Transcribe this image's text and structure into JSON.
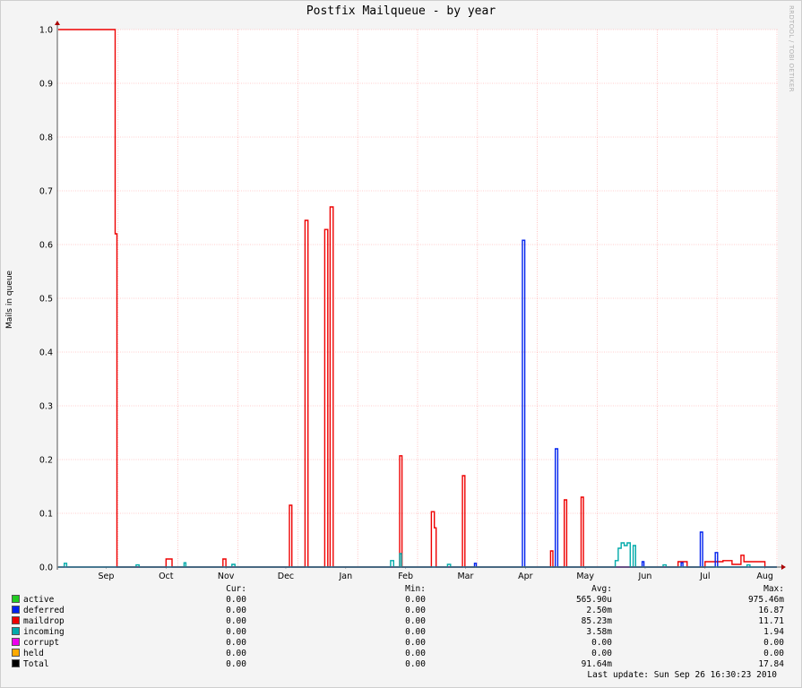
{
  "title": "Postfix Mailqueue - by year",
  "watermark": "RRDTOOL / TOBI OETIKER",
  "legend_header": {
    "cur": "Cur:",
    "min": "Min:",
    "avg": "Avg:",
    "max": "Max:"
  },
  "legend": [
    {
      "name": "active",
      "color": "#22cc22",
      "cur": "0.00",
      "min": "0.00",
      "avg": "565.90u",
      "max": "975.46m"
    },
    {
      "name": "deferred",
      "color": "#0022ee",
      "cur": "0.00",
      "min": "0.00",
      "avg": "2.50m",
      "max": "16.87"
    },
    {
      "name": "maildrop",
      "color": "#ee0000",
      "cur": "0.00",
      "min": "0.00",
      "avg": "85.23m",
      "max": "11.71"
    },
    {
      "name": "incoming",
      "color": "#00aaaa",
      "cur": "0.00",
      "min": "0.00",
      "avg": "3.58m",
      "max": "1.94"
    },
    {
      "name": "corrupt",
      "color": "#ee00ee",
      "cur": "0.00",
      "min": "0.00",
      "avg": "0.00",
      "max": "0.00"
    },
    {
      "name": "held",
      "color": "#ffaa00",
      "cur": "0.00",
      "min": "0.00",
      "avg": "0.00",
      "max": "0.00"
    },
    {
      "name": "Total",
      "color": "#000000",
      "cur": "0.00",
      "min": "0.00",
      "avg": "91.64m",
      "max": "17.84"
    }
  ],
  "last_update": "Last update: Sun Sep 26 16:30:23 2010",
  "chart_data": {
    "type": "line",
    "ylabel": "Mails in queue",
    "ylim": [
      0,
      1.0
    ],
    "xlim": [
      0,
      12
    ],
    "yticks": [
      "0.0",
      "0.1",
      "0.2",
      "0.3",
      "0.4",
      "0.5",
      "0.6",
      "0.7",
      "0.8",
      "0.9",
      "1.0"
    ],
    "xtick_labels": [
      "Sep",
      "Oct",
      "Nov",
      "Dec",
      "Jan",
      "Feb",
      "Mar",
      "Apr",
      "May",
      "Jun",
      "Jul",
      "Aug",
      "Sep"
    ],
    "grid": true,
    "series": [
      {
        "name": "maildrop",
        "color": "#ee0000",
        "points": [
          [
            0,
            1.0
          ],
          [
            0.95,
            1.0
          ],
          [
            0.95,
            0.62
          ],
          [
            0.98,
            0.62
          ],
          [
            0.98,
            0
          ],
          [
            1.8,
            0
          ],
          [
            1.8,
            0.015
          ],
          [
            1.9,
            0.015
          ],
          [
            1.9,
            0
          ],
          [
            2.75,
            0
          ],
          [
            2.75,
            0.015
          ],
          [
            2.8,
            0.015
          ],
          [
            2.8,
            0
          ],
          [
            3.86,
            0
          ],
          [
            3.86,
            0.115
          ],
          [
            3.9,
            0.115
          ],
          [
            3.9,
            0
          ],
          [
            4.12,
            0
          ],
          [
            4.12,
            0.645
          ],
          [
            4.17,
            0.645
          ],
          [
            4.17,
            0
          ],
          [
            4.45,
            0
          ],
          [
            4.45,
            0.628
          ],
          [
            4.5,
            0.628
          ],
          [
            4.5,
            0
          ],
          [
            4.54,
            0
          ],
          [
            4.54,
            0.67
          ],
          [
            4.59,
            0.67
          ],
          [
            4.59,
            0
          ],
          [
            5.7,
            0
          ],
          [
            5.7,
            0.207
          ],
          [
            5.74,
            0.207
          ],
          [
            5.74,
            0
          ],
          [
            6.23,
            0
          ],
          [
            6.23,
            0.103
          ],
          [
            6.28,
            0.103
          ],
          [
            6.28,
            0.073
          ],
          [
            6.31,
            0.073
          ],
          [
            6.31,
            0
          ],
          [
            6.75,
            0
          ],
          [
            6.75,
            0.17
          ],
          [
            6.79,
            0.17
          ],
          [
            6.79,
            0
          ],
          [
            8.22,
            0
          ],
          [
            8.22,
            0.03
          ],
          [
            8.26,
            0.03
          ],
          [
            8.26,
            0
          ],
          [
            8.45,
            0
          ],
          [
            8.45,
            0.125
          ],
          [
            8.49,
            0.125
          ],
          [
            8.49,
            0
          ],
          [
            8.73,
            0
          ],
          [
            8.73,
            0.13
          ],
          [
            8.77,
            0.13
          ],
          [
            8.77,
            0
          ],
          [
            10.35,
            0
          ],
          [
            10.35,
            0.01
          ],
          [
            10.5,
            0.01
          ],
          [
            10.5,
            0
          ],
          [
            10.8,
            0
          ],
          [
            10.8,
            0.01
          ],
          [
            11.1,
            0.01
          ],
          [
            11.1,
            0.012
          ],
          [
            11.25,
            0.012
          ],
          [
            11.25,
            0.005
          ],
          [
            11.4,
            0.005
          ],
          [
            11.4,
            0.022
          ],
          [
            11.45,
            0.022
          ],
          [
            11.45,
            0.01
          ],
          [
            11.8,
            0.01
          ],
          [
            11.8,
            0
          ],
          [
            12,
            0
          ]
        ]
      },
      {
        "name": "deferred",
        "color": "#0022ee",
        "points": [
          [
            0,
            0
          ],
          [
            6.95,
            0
          ],
          [
            6.95,
            0.007
          ],
          [
            6.98,
            0.007
          ],
          [
            6.98,
            0
          ],
          [
            7.75,
            0
          ],
          [
            7.75,
            0.608
          ],
          [
            7.79,
            0.608
          ],
          [
            7.79,
            0
          ],
          [
            8.3,
            0
          ],
          [
            8.3,
            0.22
          ],
          [
            8.34,
            0.22
          ],
          [
            8.34,
            0
          ],
          [
            9.75,
            0
          ],
          [
            9.75,
            0.01
          ],
          [
            9.78,
            0.01
          ],
          [
            9.78,
            0
          ],
          [
            10.4,
            0
          ],
          [
            10.4,
            0.008
          ],
          [
            10.43,
            0.008
          ],
          [
            10.43,
            0
          ],
          [
            10.72,
            0
          ],
          [
            10.72,
            0.065
          ],
          [
            10.76,
            0.065
          ],
          [
            10.76,
            0
          ],
          [
            10.97,
            0
          ],
          [
            10.97,
            0.027
          ],
          [
            11.01,
            0.027
          ],
          [
            11.01,
            0
          ],
          [
            12,
            0
          ]
        ]
      },
      {
        "name": "incoming",
        "color": "#00aaaa",
        "points": [
          [
            0,
            0
          ],
          [
            0.1,
            0
          ],
          [
            0.1,
            0.007
          ],
          [
            0.14,
            0.007
          ],
          [
            0.14,
            0
          ],
          [
            1.3,
            0
          ],
          [
            1.3,
            0.004
          ],
          [
            1.35,
            0.004
          ],
          [
            1.35,
            0
          ],
          [
            2.1,
            0
          ],
          [
            2.1,
            0.008
          ],
          [
            2.13,
            0.008
          ],
          [
            2.13,
            0
          ],
          [
            2.9,
            0
          ],
          [
            2.9,
            0.005
          ],
          [
            2.95,
            0.005
          ],
          [
            2.95,
            0
          ],
          [
            5.55,
            0
          ],
          [
            5.55,
            0.012
          ],
          [
            5.6,
            0.012
          ],
          [
            5.6,
            0
          ],
          [
            5.7,
            0
          ],
          [
            5.7,
            0.025
          ],
          [
            5.73,
            0.025
          ],
          [
            5.73,
            0
          ],
          [
            6.5,
            0
          ],
          [
            6.5,
            0.005
          ],
          [
            6.55,
            0.005
          ],
          [
            6.55,
            0
          ],
          [
            9.3,
            0
          ],
          [
            9.3,
            0.012
          ],
          [
            9.35,
            0.012
          ],
          [
            9.35,
            0.035
          ],
          [
            9.4,
            0.035
          ],
          [
            9.4,
            0.045
          ],
          [
            9.45,
            0.045
          ],
          [
            9.45,
            0.04
          ],
          [
            9.5,
            0.04
          ],
          [
            9.5,
            0.045
          ],
          [
            9.55,
            0.045
          ],
          [
            9.55,
            0
          ],
          [
            9.6,
            0
          ],
          [
            9.6,
            0.04
          ],
          [
            9.64,
            0.04
          ],
          [
            9.64,
            0
          ],
          [
            10.1,
            0
          ],
          [
            10.1,
            0.004
          ],
          [
            10.15,
            0.004
          ],
          [
            10.15,
            0
          ],
          [
            11.5,
            0
          ],
          [
            11.5,
            0.004
          ],
          [
            11.55,
            0.004
          ],
          [
            11.55,
            0
          ],
          [
            12,
            0
          ]
        ]
      }
    ]
  }
}
